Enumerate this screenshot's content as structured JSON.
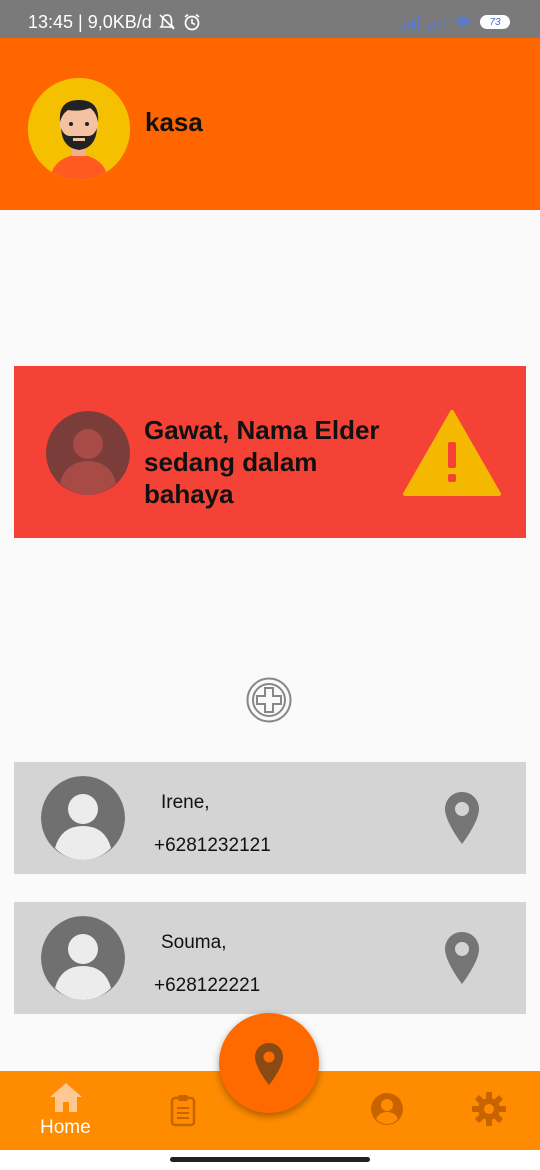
{
  "status_bar": {
    "time_text": "13:45 | 9,0KB/d",
    "battery": "73",
    "icons": [
      "mute-bell-icon",
      "alarm-icon",
      "signal-icon",
      "signal-icon",
      "wifi-icon",
      "battery-icon"
    ]
  },
  "header": {
    "username": "kasa",
    "avatar_icon": "man-beard-avatar"
  },
  "alert": {
    "message": "Gawat, Nama Elder sedang dalam bahaya",
    "avatar_icon": "person-icon",
    "warning_icon": "warning-triangle-icon"
  },
  "add_icon": "plus-circle-icon",
  "contacts": [
    {
      "name": "Irene,",
      "phone": "+6281232121",
      "action_icon": "location-pin-icon"
    },
    {
      "name": "Souma,",
      "phone": "+628122221",
      "action_icon": "location-pin-icon"
    }
  ],
  "bottom_nav": {
    "items": [
      {
        "label": "Home",
        "icon": "home-icon"
      },
      {
        "label": "",
        "icon": "clipboard-icon"
      },
      {
        "label": "",
        "icon": "location-pin-icon"
      },
      {
        "label": "",
        "icon": "account-icon"
      },
      {
        "label": "",
        "icon": "gear-icon"
      }
    ]
  },
  "colors": {
    "header": "#ff6600",
    "alert": "#f44336",
    "bottom_nav": "#ff8c00",
    "contact_card": "#d4d4d4",
    "warning": "#f5b800"
  }
}
